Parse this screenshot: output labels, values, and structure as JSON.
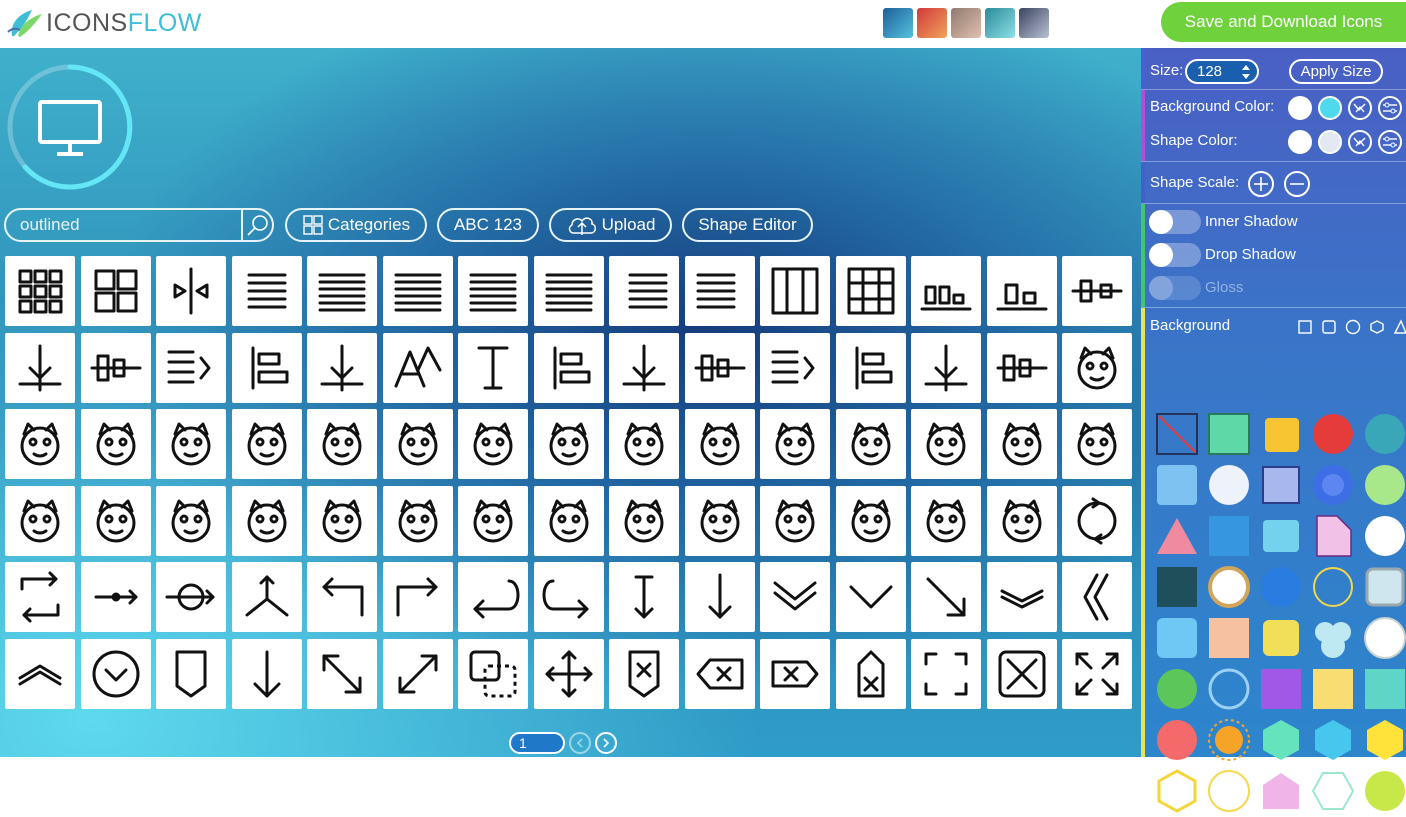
{
  "app": {
    "logo_part1": "ICONS",
    "logo_part2": "FLOW"
  },
  "header": {
    "theme_swatches": [
      {
        "name": "ocean",
        "from": "#1f5f9a",
        "to": "#55c2de"
      },
      {
        "name": "sunset",
        "from": "#d23a3a",
        "to": "#f0a35c"
      },
      {
        "name": "sand",
        "from": "#8f7a6e",
        "to": "#e0c0b0"
      },
      {
        "name": "teal",
        "from": "#2a8a9a",
        "to": "#8ee0e6"
      },
      {
        "name": "slate",
        "from": "#3b4460",
        "to": "#b9c2d4"
      }
    ],
    "save_label": "Save and Download Icons"
  },
  "toolbar": {
    "search_value": "outlined",
    "categories_label": "Categories",
    "abc_label": "ABC 123",
    "upload_label": "Upload",
    "shape_editor_label": "Shape Editor"
  },
  "icons": [
    "grid-3x3-icon",
    "grid-2x2-icon",
    "flip-horizontal-icon",
    "align-center-icon",
    "align-justify-icon",
    "align-justify-alt-icon",
    "align-justify-wide-icon",
    "align-left-icon",
    "align-right-icon",
    "align-left-short-icon",
    "columns-icon",
    "table-grid-icon",
    "bar-chart-bottom-icon",
    "align-bottom-icon",
    "distribute-center-icon",
    "distribute-horizontal-icon",
    "align-top-bars-icon",
    "align-top-icon",
    "text-wrap-right-icon",
    "text-wrap-left-icon",
    "font-size-icon",
    "text-cursor-icon",
    "align-bottom-arrow-icon",
    "align-vertical-center-icon",
    "align-left-bars-icon",
    "align-left-arrow-icon",
    "align-right-bars-icon",
    "align-right-arrow-icon",
    "align-top-arrow-icon",
    "frog-icon",
    "bat-icon",
    "bear-icon",
    "bee-icon",
    "bird-icon",
    "beetle-icon",
    "butterfly-icon",
    "cat-icon",
    "cheetah-icon",
    "cow-icon",
    "elephant-icon",
    "dolphin-icon",
    "dove-icon",
    "duck-icon",
    "eagle-icon",
    "fish-icon",
    "fox-icon",
    "hippo-icon",
    "horse-icon",
    "koala-icon",
    "tiger-icon",
    "lion-icon",
    "monkey-icon",
    "mouse-icon",
    "whale-icon",
    "sheep-icon",
    "seal-icon",
    "spider-icon",
    "tiger-face-icon",
    "wolf-icon",
    "refresh-circle-icon",
    "repeat-icon",
    "arrow-right-dot-icon",
    "arrow-right-circle-icon",
    "three-way-arrows-icon",
    "arrow-turn-left-icon",
    "arrow-turn-right-icon",
    "arrow-return-left-icon",
    "arrow-return-right-icon",
    "arrow-up-down-icon",
    "arrow-down-icon",
    "chevron-double-down-icon",
    "chevron-down-icon",
    "arrow-down-right-icon",
    "chevron-double-down-thin-icon",
    "chevron-double-left-icon",
    "chevron-double-up-icon",
    "chevron-circle-down-icon",
    "bookmark-icon",
    "arrow-down-long-icon",
    "expand-diagonal-icon",
    "expand-diagonal-alt-icon",
    "resize-icon",
    "move-icon",
    "bookmark-x-icon",
    "backspace-icon",
    "tag-x-icon",
    "tag-x-vertical-icon",
    "focus-frame-icon",
    "expand-box-icon",
    "fullscreen-icon"
  ],
  "pagination": {
    "current": "1"
  },
  "panel": {
    "size_label": "Size:",
    "size_value": "128",
    "apply_label": "Apply Size",
    "bg_color_label": "Background Color:",
    "shape_color_label": "Shape Color:",
    "shape_scale_label": "Shape Scale:",
    "inner_shadow_label": "Inner Shadow",
    "drop_shadow_label": "Drop Shadow",
    "gloss_label": "Gloss",
    "background_label": "Background",
    "accent_colors": {
      "size": "#4b5fd4",
      "color": "#b04fd8",
      "scale": "#3f62c8",
      "shadow": "#45c46f",
      "background": "#e4e35a"
    },
    "bg_color_selected": "#4fd9ef",
    "shape_color_selected": "#e3e9f3"
  }
}
